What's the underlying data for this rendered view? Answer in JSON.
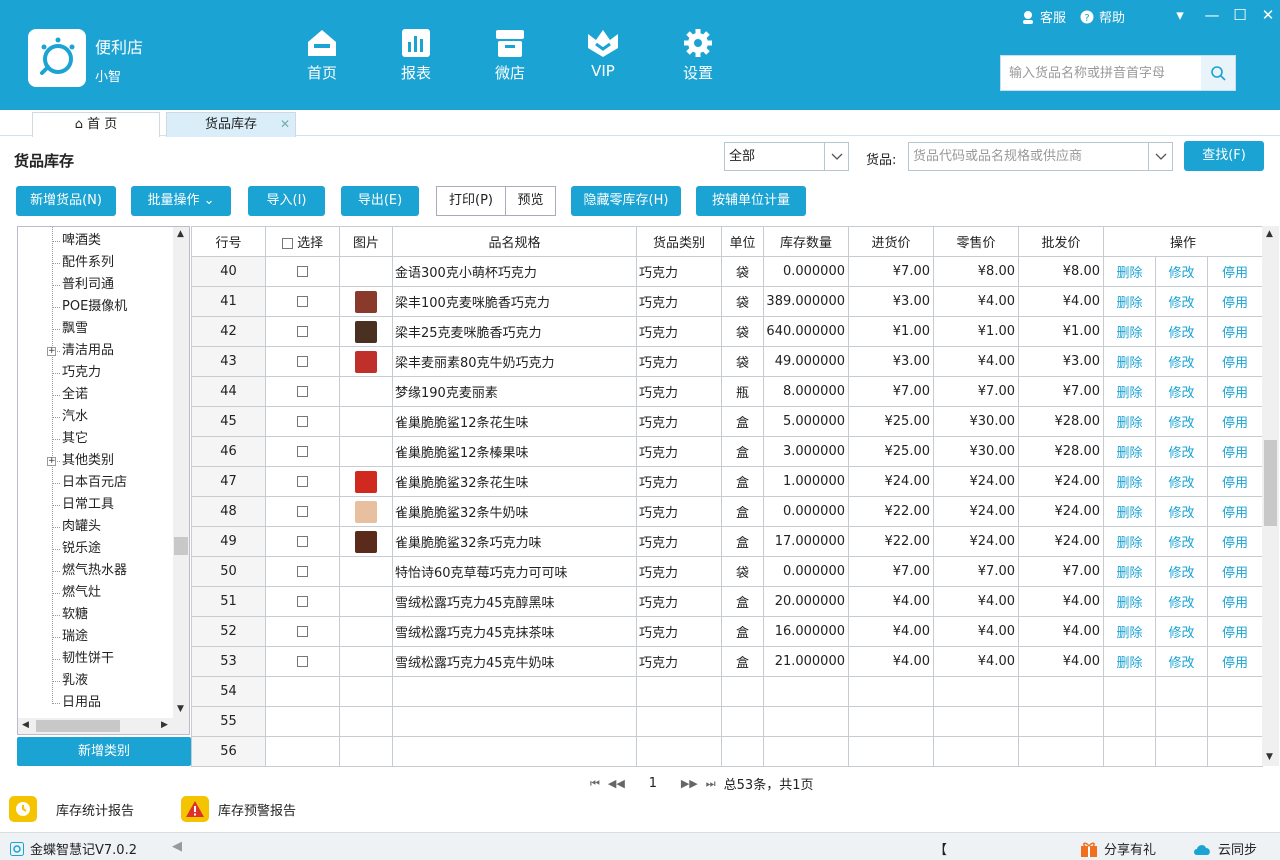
{
  "app": {
    "shop_name": "便利店",
    "user": "小智",
    "service": "客服",
    "help": "帮助",
    "version": "金蝶智慧记V7.0.2",
    "share": "分享有礼",
    "cloud_sync": "云同步",
    "status_mark": "【"
  },
  "nav": [
    {
      "label": "首页",
      "icon": "home-icon"
    },
    {
      "label": "报表",
      "icon": "bar-chart-icon"
    },
    {
      "label": "微店",
      "icon": "store-icon"
    },
    {
      "label": "VIP",
      "icon": "crown-icon"
    },
    {
      "label": "设置",
      "icon": "gear-icon"
    }
  ],
  "header_search": {
    "placeholder": "输入货品名称或拼音首字母"
  },
  "tabs": [
    {
      "label": "首 页"
    },
    {
      "label": "货品库存"
    }
  ],
  "page_title": "货品库存",
  "filter": {
    "category_value": "全部",
    "goods_label": "货品:",
    "goods_placeholder": "货品代码或品名规格或供应商",
    "find_label": "查找(F)"
  },
  "toolbar": {
    "add_goods": "新增货品(N)",
    "batch": "批量操作",
    "import": "导入(I)",
    "export": "导出(E)",
    "print": "打印(P)",
    "preview": "预览",
    "hide_zero": "隐藏零库存(H)",
    "aux_unit": "按辅单位计量"
  },
  "tree": {
    "items": [
      "啤酒类",
      "配件系列",
      "普利司通",
      "POE摄像机",
      "飘雪",
      "清洁用品",
      "巧克力",
      "全诺",
      "汽水",
      "其它",
      "其他类别",
      "日本百元店",
      "日常工具",
      "肉罐头",
      "锐乐途",
      "燃气热水器",
      "燃气灶",
      "软糖",
      "瑞途",
      "韧性饼干",
      "乳液",
      "日用品"
    ],
    "expandable": [
      5,
      10
    ],
    "add_label": "新增类别"
  },
  "table": {
    "headers": [
      "行号",
      "选择",
      "图片",
      "品名规格",
      "货品类别",
      "单位",
      "库存数量",
      "进货价",
      "零售价",
      "批发价",
      "操作"
    ],
    "actions": [
      "删除",
      "修改",
      "停用"
    ],
    "rows": [
      {
        "no": "40",
        "name": "金语300克小萌杯巧克力",
        "cat": "巧克力",
        "unit": "袋",
        "qty": "0.000000",
        "buy": "¥7.00",
        "retail": "¥8.00",
        "whole": "¥8.00",
        "img": ""
      },
      {
        "no": "41",
        "name": "梁丰100克麦咪脆香巧克力",
        "cat": "巧克力",
        "unit": "袋",
        "qty": "389.000000",
        "buy": "¥3.00",
        "retail": "¥4.00",
        "whole": "¥4.00",
        "img": "#8a3a2a"
      },
      {
        "no": "42",
        "name": "梁丰25克麦咪脆香巧克力",
        "cat": "巧克力",
        "unit": "袋",
        "qty": "640.000000",
        "buy": "¥1.00",
        "retail": "¥1.00",
        "whole": "¥1.00",
        "img": "#4a3020"
      },
      {
        "no": "43",
        "name": "梁丰麦丽素80克牛奶巧克力",
        "cat": "巧克力",
        "unit": "袋",
        "qty": "49.000000",
        "buy": "¥3.00",
        "retail": "¥4.00",
        "whole": "¥3.00",
        "img": "#c0302a"
      },
      {
        "no": "44",
        "name": "梦缘190克麦丽素",
        "cat": "巧克力",
        "unit": "瓶",
        "qty": "8.000000",
        "buy": "¥7.00",
        "retail": "¥7.00",
        "whole": "¥7.00",
        "img": ""
      },
      {
        "no": "45",
        "name": "雀巢脆脆鲨12条花生味",
        "cat": "巧克力",
        "unit": "盒",
        "qty": "5.000000",
        "buy": "¥25.00",
        "retail": "¥30.00",
        "whole": "¥28.00",
        "img": ""
      },
      {
        "no": "46",
        "name": "雀巢脆脆鲨12条榛果味",
        "cat": "巧克力",
        "unit": "盒",
        "qty": "3.000000",
        "buy": "¥25.00",
        "retail": "¥30.00",
        "whole": "¥28.00",
        "img": ""
      },
      {
        "no": "47",
        "name": "雀巢脆脆鲨32条花生味",
        "cat": "巧克力",
        "unit": "盒",
        "qty": "1.000000",
        "buy": "¥24.00",
        "retail": "¥24.00",
        "whole": "¥24.00",
        "img": "#d02a20"
      },
      {
        "no": "48",
        "name": "雀巢脆脆鲨32条牛奶味",
        "cat": "巧克力",
        "unit": "盒",
        "qty": "0.000000",
        "buy": "¥22.00",
        "retail": "¥24.00",
        "whole": "¥24.00",
        "img": "#e8c0a0"
      },
      {
        "no": "49",
        "name": "雀巢脆脆鲨32条巧克力味",
        "cat": "巧克力",
        "unit": "盒",
        "qty": "17.000000",
        "buy": "¥22.00",
        "retail": "¥24.00",
        "whole": "¥24.00",
        "img": "#5a2a1a"
      },
      {
        "no": "50",
        "name": "特怡诗60克草莓巧克力可可味",
        "cat": "巧克力",
        "unit": "袋",
        "qty": "0.000000",
        "buy": "¥7.00",
        "retail": "¥7.00",
        "whole": "¥7.00",
        "img": ""
      },
      {
        "no": "51",
        "name": "雪绒松露巧克力45克醇黑味",
        "cat": "巧克力",
        "unit": "盒",
        "qty": "20.000000",
        "buy": "¥4.00",
        "retail": "¥4.00",
        "whole": "¥4.00",
        "img": ""
      },
      {
        "no": "52",
        "name": "雪绒松露巧克力45克抹茶味",
        "cat": "巧克力",
        "unit": "盒",
        "qty": "16.000000",
        "buy": "¥4.00",
        "retail": "¥4.00",
        "whole": "¥4.00",
        "img": ""
      },
      {
        "no": "53",
        "name": "雪绒松露巧克力45克牛奶味",
        "cat": "巧克力",
        "unit": "盒",
        "qty": "21.000000",
        "buy": "¥4.00",
        "retail": "¥4.00",
        "whole": "¥4.00",
        "img": ""
      }
    ],
    "empty_rows": [
      "54",
      "55",
      "56"
    ]
  },
  "pager": {
    "page": "1",
    "summary": "总53条，共1页"
  },
  "reports": [
    {
      "label": "库存统计报告",
      "icon": "clock-report-icon"
    },
    {
      "label": "库存预警报告",
      "icon": "warning-icon"
    }
  ]
}
